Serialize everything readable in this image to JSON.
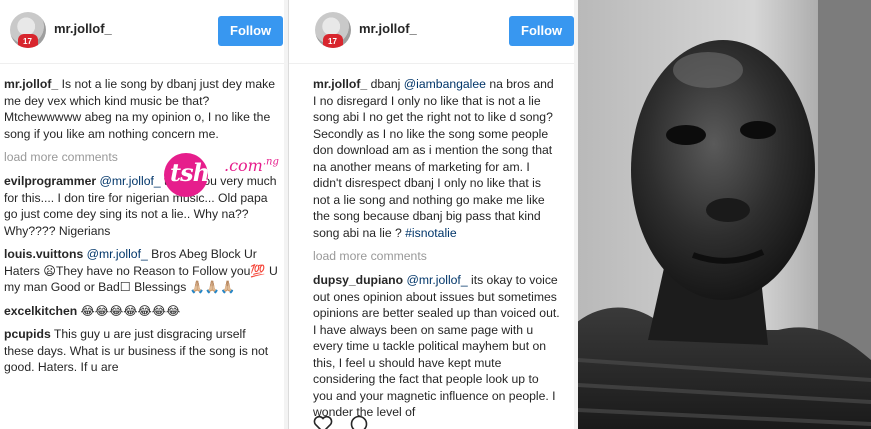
{
  "left_post": {
    "username": "mr.jollof_",
    "avatar_number": "17",
    "follow_label": "Follow",
    "comments_before": [
      {
        "user": "mr.jollof_",
        "text": " Is not a lie song by dbanj just dey make me dey vex which kind music be that? Mtchewwwww abeg na my opinion o, I no like the song if you like am nothing concern me."
      }
    ],
    "load_more": "load more comments",
    "comments_after": [
      {
        "user": "evilprogrammer",
        "mention": "@mr.jollof_",
        "text": " thank you very much for this.... I don tire for nigerian music... Old papa go just come dey sing its not a lie.. Why na?? Why???? Nigerians"
      },
      {
        "user": "louis.vuittons",
        "mention": "@mr.jollof_",
        "text": " Bros Abeg Block Ur Haters 😦They have no Reason to Follow you💯 U my man Good or Bad☐ Blessings 🙏🏼🙏🏼🙏🏼"
      },
      {
        "user": "excelkitchen",
        "mention": "",
        "text": " 😂😂😂😂😂😂😂"
      },
      {
        "user": "pcupids",
        "mention": "",
        "text": " This guy u are just disgracing urself these days. What is ur business if the song is not good. Haters. If u are"
      }
    ]
  },
  "watermark": {
    "logo": "tsh",
    "domain": ".com",
    "suffix": ".ng"
  },
  "mid_post": {
    "username": "mr.jollof_",
    "avatar_number": "17",
    "follow_label": "Follow",
    "caption": {
      "user": "mr.jollof_",
      "pre": " dbanj ",
      "mention": "@iambangalee",
      "text": " na bros and I no disregard I only no like that is not a lie song abi I no get the right not to like d song? Secondly as I no like the song some people don download am as i mention the song that na another means of marketing for am. I didn't disrespect dbanj I only no like that is not a lie song and nothing go make me like the song because dbanj big pass that kind song abi na lie ? ",
      "hashtag": "#isnotalie"
    },
    "load_more": "load more comments",
    "comments": [
      {
        "user": "dupsy_dupiano",
        "mention": "@mr.jollof_",
        "text": " its okay to voice out ones opinion about issues but sometimes opinions are better sealed up than voiced out. I have always been on same page with u every time u tackle political mayhem but on this, I feel u should have kept mute considering the fact that people look up to you and your magnetic influence on people. I wonder the level of"
      }
    ]
  }
}
